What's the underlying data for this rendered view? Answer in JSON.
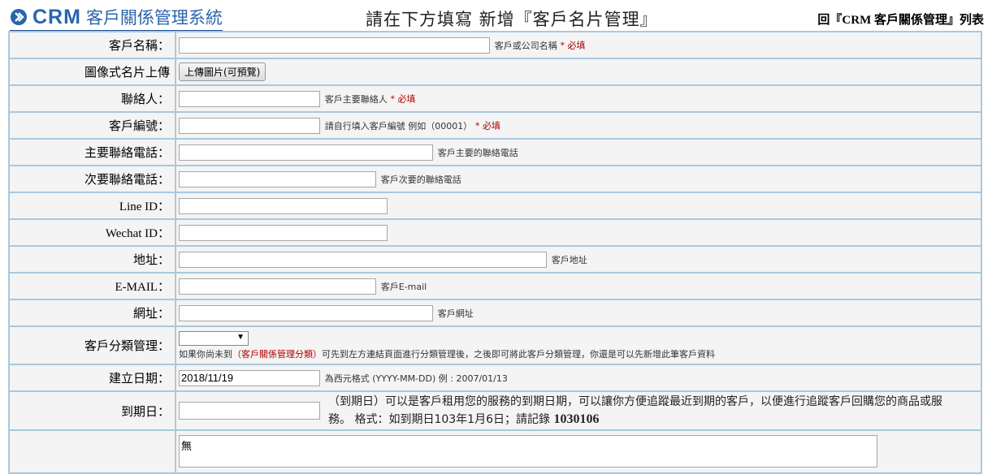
{
  "header": {
    "logo_crm": "CRM",
    "logo_sys": "客戶關係管理系統",
    "page_title": "請在下方填寫 新增『客戶名片管理』",
    "back_link": "回『CRM 客戶關係管理』列表"
  },
  "form": {
    "customer_name": {
      "label": "客戶名稱：",
      "value": "",
      "note": "客戶或公司名稱",
      "required": "* 必填"
    },
    "card_upload": {
      "label": "圖像式名片上傳",
      "button": "上傳圖片(可預覽)"
    },
    "contact": {
      "label": "聯絡人：",
      "value": "",
      "note": "客戶主要聯絡人",
      "required": "* 必填"
    },
    "customer_no": {
      "label": "客戶編號：",
      "value": "",
      "note": "請自行填入客戶編號 例如（00001）",
      "required": "* 必填"
    },
    "phone_main": {
      "label": "主要聯絡電話：",
      "value": "",
      "note": "客戶主要的聯絡電話"
    },
    "phone_alt": {
      "label": "次要聯絡電話：",
      "value": "",
      "note": "客戶次要的聯絡電話"
    },
    "line_id": {
      "label": "Line ID：",
      "value": ""
    },
    "wechat_id": {
      "label": "Wechat ID：",
      "value": ""
    },
    "address": {
      "label": "地址：",
      "value": "",
      "note": "客戶地址"
    },
    "email": {
      "label": "E-MAIL：",
      "value": "",
      "note": "客戶E-mail"
    },
    "website": {
      "label": "網址：",
      "value": "",
      "note": "客戶網址"
    },
    "category": {
      "label": "客戶分類管理：",
      "selected": "",
      "note_pre": "如果你尚未到",
      "note_link": "（客戶關係管理分類）",
      "note_post": "可先到左方連結頁面進行分類管理後，之後即可將此客戶分類管理，你還是可以先新增此筆客戶資料"
    },
    "created_date": {
      "label": "建立日期：",
      "value": "2018/11/19",
      "note": "為西元格式 (YYYY-MM-DD) 例 : 2007/01/13"
    },
    "expiry_date": {
      "label": "到期日：",
      "value": "",
      "note": "（到期日）可以是客戶租用您的服務的到期日期，可以讓你方便追蹤最近到期的客戶，以便進行追蹤客戶回購您的商品或服務。 格式：如到期日103年1月6日；請記錄",
      "note_bold": "1030106"
    },
    "memo": {
      "label": "",
      "value": "無"
    }
  },
  "colors": {
    "brand": "#2a64ad",
    "required": "#b00000",
    "grid": "#a9c8de"
  }
}
